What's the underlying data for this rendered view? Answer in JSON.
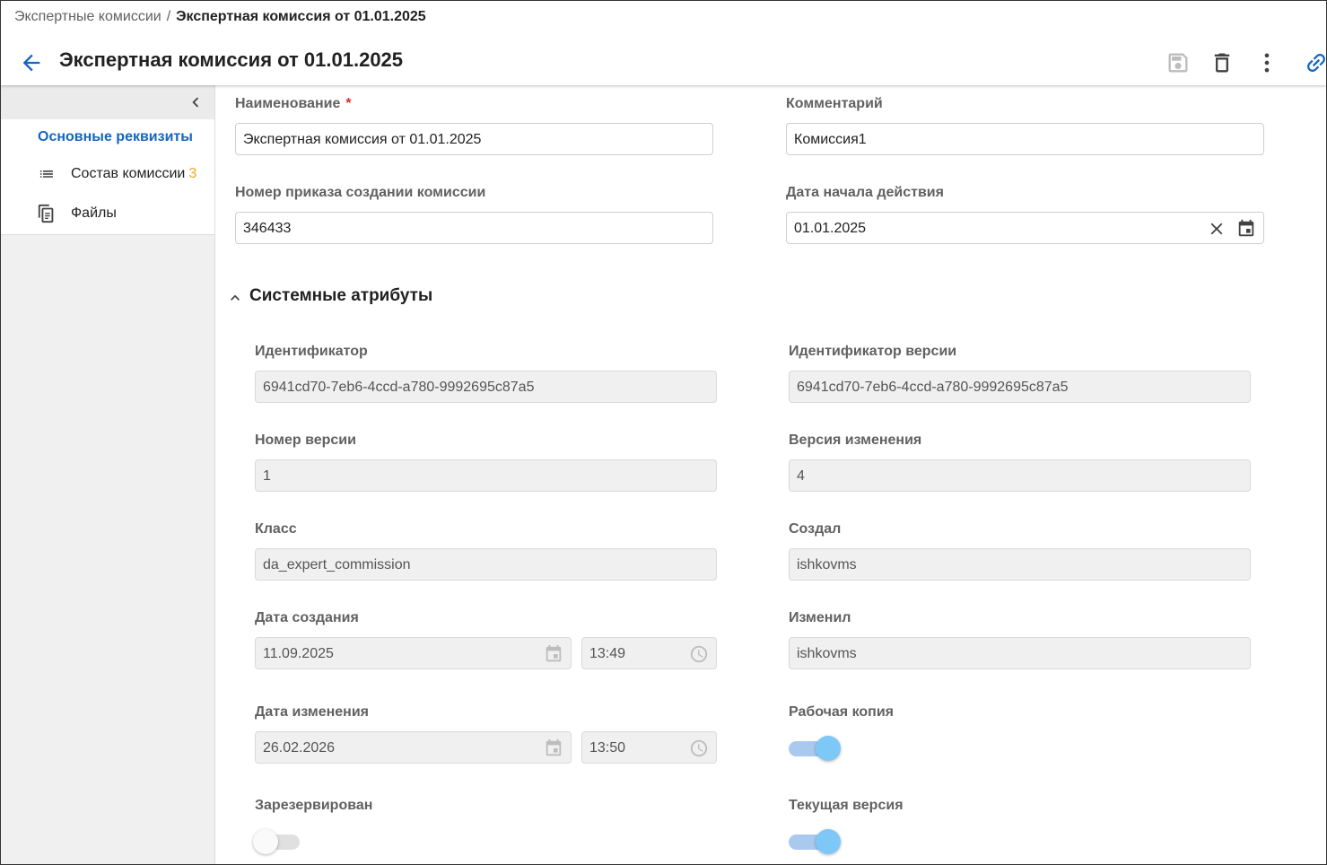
{
  "breadcrumb": {
    "parent": "Экспертные комиссии",
    "separator": "/",
    "current": "Экспертная комиссия от 01.01.2025"
  },
  "page": {
    "title": "Экспертная комиссия от 01.01.2025"
  },
  "toolbar": {
    "icons": [
      "save-icon",
      "delete-icon",
      "more-vert-icon",
      "link-icon"
    ]
  },
  "sidebar": {
    "items": [
      {
        "label": "Основные реквизиты",
        "active": true
      },
      {
        "label": "Состав комиссии",
        "badge": "3",
        "icon": "list-icon"
      },
      {
        "label": "Файлы",
        "icon": "files-icon"
      }
    ]
  },
  "form": {
    "name": {
      "label": "Наименование",
      "required_mark": "*",
      "value": "Экспертная комиссия от 01.01.2025"
    },
    "comment": {
      "label": "Комментарий",
      "value": "Комиссия1"
    },
    "order_number": {
      "label": "Номер приказа создании комиссии",
      "value": "346433"
    },
    "start_date": {
      "label": "Дата начала действия",
      "value": "01.01.2025"
    }
  },
  "system": {
    "title": "Системные атрибуты",
    "identifier": {
      "label": "Идентификатор",
      "value": "6941cd70-7eb6-4ccd-a780-9992695c87a5"
    },
    "version_identifier": {
      "label": "Идентификатор версии",
      "value": "6941cd70-7eb6-4ccd-a780-9992695c87a5"
    },
    "version_number": {
      "label": "Номер версии",
      "value": "1"
    },
    "change_version": {
      "label": "Версия изменения",
      "value": "4"
    },
    "class": {
      "label": "Класс",
      "value": "da_expert_commission"
    },
    "created_by": {
      "label": "Создал",
      "value": "ishkovms"
    },
    "created_at": {
      "label": "Дата создания",
      "date": "11.09.2025",
      "time": "13:49"
    },
    "modified_by": {
      "label": "Изменил",
      "value": "ishkovms"
    },
    "modified_at": {
      "label": "Дата изменения",
      "date": "26.02.2026",
      "time": "13:50"
    },
    "working_copy": {
      "label": "Рабочая копия",
      "on": true
    },
    "reserved": {
      "label": "Зарезервирован",
      "on": false
    },
    "current_version": {
      "label": "Текущая версия",
      "on": true
    }
  },
  "colors": {
    "accent": "#1565c0",
    "badge": "#f5a623",
    "required": "#d32f2f",
    "toggle_on": "#7ec8f8"
  }
}
